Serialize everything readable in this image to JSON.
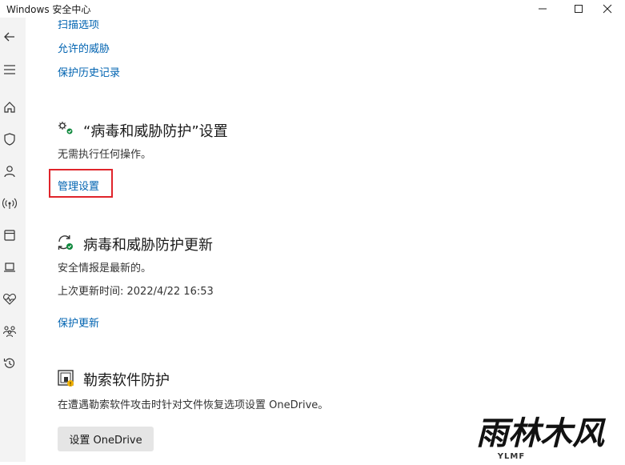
{
  "window": {
    "title": "Windows 安全中心"
  },
  "scan_section": {
    "links": [
      {
        "label": "扫描选项"
      },
      {
        "label": "允许的威胁"
      },
      {
        "label": "保护历史记录"
      }
    ]
  },
  "settings_section": {
    "heading": "“病毒和威胁防护”设置",
    "status": "无需执行任何操作。",
    "manage_link": "管理设置"
  },
  "update_section": {
    "heading": "病毒和威胁防护更新",
    "status": "安全情报是最新的。",
    "last_update": "上次更新时间: 2022/4/22 16:53",
    "update_link": "保护更新"
  },
  "ransomware_section": {
    "heading": "勒索软件防护",
    "description": "在遭遇勒索软件攻击时针对文件恢复选项设置 OneDrive。",
    "button_label": "设置 OneDrive"
  },
  "watermark": {
    "logo": "雨林木风",
    "sub": "YLMF"
  },
  "colors": {
    "link": "#0063b1",
    "highlight": "#e0242b",
    "check_green": "#10893e"
  }
}
